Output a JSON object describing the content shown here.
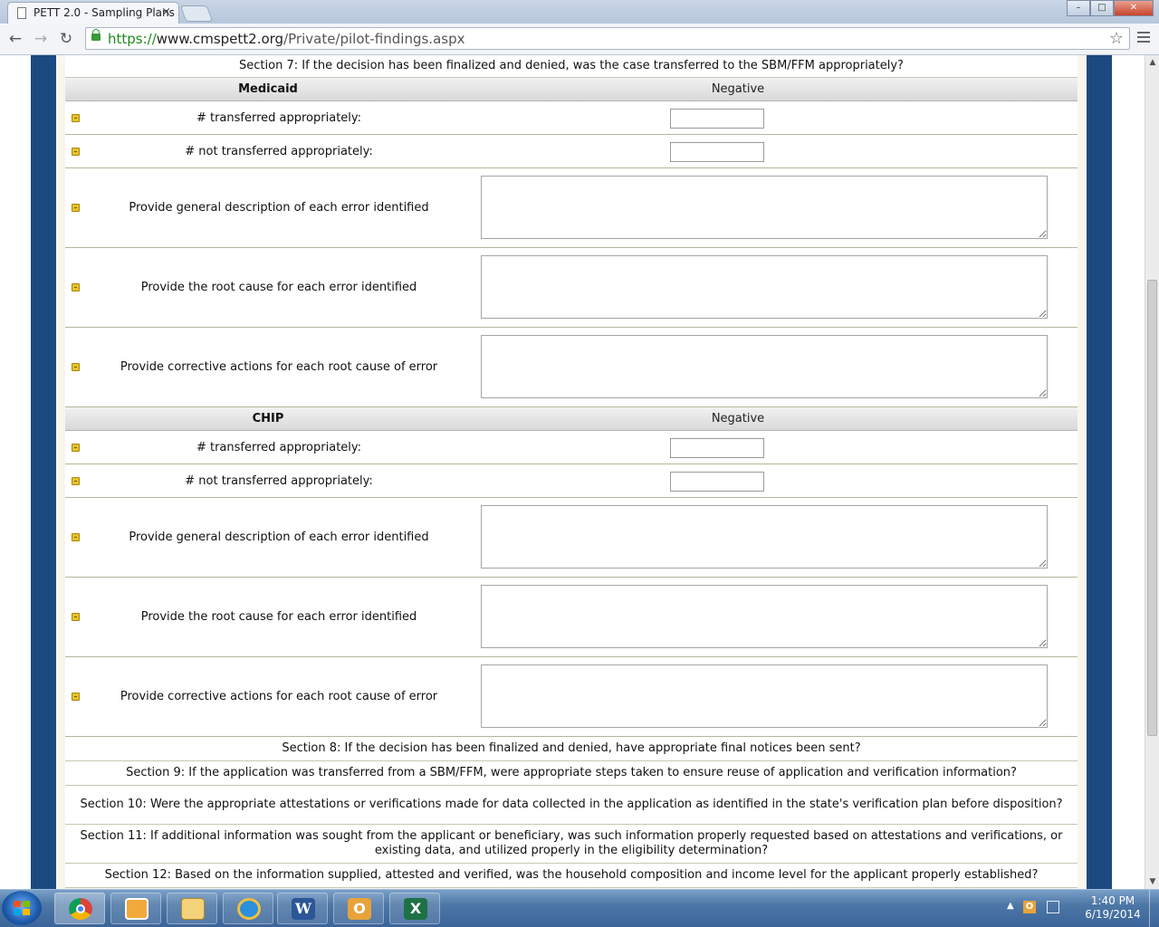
{
  "browser": {
    "tab_title": "PETT 2.0 - Sampling Plans",
    "tab_close": "×",
    "url_scheme": "https://",
    "url_host": "www.cmspett2.org",
    "url_path": "/Private/pilot-findings.aspx",
    "nav_back": "←",
    "nav_forward": "→",
    "nav_reload": "↻",
    "star": "☆",
    "window_minimize": "–",
    "window_maximize": "□",
    "window_close": "✕"
  },
  "page": {
    "section7": "Section 7: If the decision has been finalized and denied, was the case transferred to the SBM/FFM appropriately?",
    "medicaid": {
      "title": "Medicaid",
      "column": "Negative",
      "transferred_label": "# transferred appropriately:",
      "transferred_value": "",
      "not_transferred_label": "# not transferred appropriately:",
      "not_transferred_value": "",
      "description_label": "Provide general description of each error identified",
      "description_value": "",
      "root_cause_label": "Provide the root cause for each error identified",
      "root_cause_value": "",
      "corrective_label": "Provide corrective actions for each root cause of error",
      "corrective_value": ""
    },
    "chip": {
      "title": "CHIP",
      "column": "Negative",
      "transferred_label": "# transferred appropriately:",
      "transferred_value": "",
      "not_transferred_label": "# not transferred appropriately:",
      "not_transferred_value": "",
      "description_label": "Provide general description of each error identified",
      "description_value": "",
      "root_cause_label": "Provide the root cause for each error identified",
      "root_cause_value": "",
      "corrective_label": "Provide corrective actions for each root cause of error",
      "corrective_value": ""
    },
    "section8": "Section 8: If the decision has been finalized and denied, have appropriate final notices been sent?",
    "section9": "Section 9: If the application was transferred from a SBM/FFM, were appropriate steps taken to ensure reuse of application and verification information?",
    "section10": "Section 10: Were the appropriate attestations or verifications made for data collected in the application as identified in the state's verification plan before disposition?",
    "section11": "Section 11: If additional information was sought from the applicant or beneficiary, was such information properly requested based on attestations and verifications, or existing data, and utilized properly in the eligibility determination?",
    "section12": "Section 12: Based on the information supplied, attested and verified, was the household composition and income level for the applicant properly established?"
  },
  "scrollbar": {
    "up_arrow": "▲",
    "down_arrow": "▼"
  },
  "taskbar": {
    "word_glyph": "W",
    "outlook_glyph": "O",
    "excel_glyph": "X",
    "tray_arrow": "▲",
    "tray_outlook_glyph": "O",
    "time": "1:40 PM",
    "date": "6/19/2014"
  },
  "icons": {
    "tab": "page-icon",
    "lock": "lock-icon",
    "bookmark": "star-icon",
    "menu": "hamburger-menu-icon",
    "bullet": "yellow-square-bullet-icon"
  }
}
